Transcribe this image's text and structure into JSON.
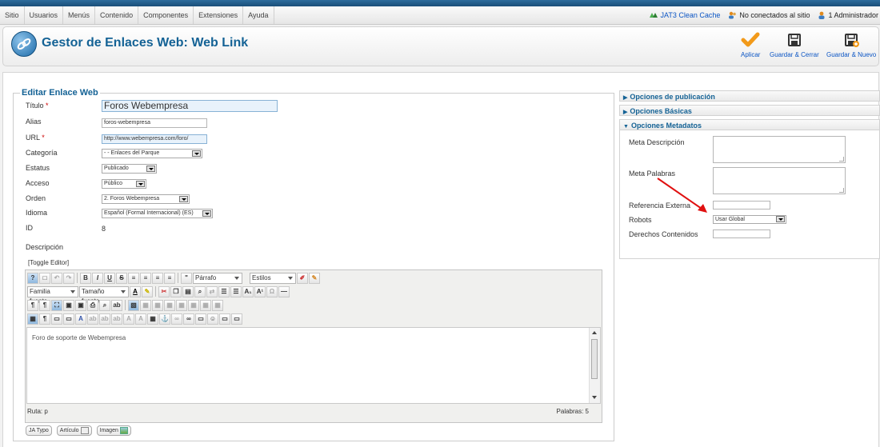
{
  "menu": {
    "items": [
      "Sitio",
      "Usuarios",
      "Menús",
      "Contenido",
      "Componentes",
      "Extensiones",
      "Ayuda"
    ],
    "cache_label": "JAT3 Clean Cache",
    "not_connected": "No conectados al sitio",
    "admin": "1 Administrador"
  },
  "header": {
    "title": "Gestor de Enlaces Web: Web Link",
    "apply_label": "Aplicar",
    "save_close_label": "Guardar & Cerrar",
    "save_new_label": "Guardar & Nuevo"
  },
  "form": {
    "legend": "Editar Enlace Web",
    "title_label": "Título",
    "required_mark": "*",
    "title_value": "Foros Webempresa",
    "alias_label": "Alias",
    "alias_value": "foros-webempresa",
    "url_label": "URL",
    "url_value": "http://www.webempresa.com/foro/",
    "category_label": "Categoría",
    "category_value": "- - Enlaces del Parque",
    "status_label": "Estatus",
    "status_value": "Publicado",
    "access_label": "Acceso",
    "access_value": "Público",
    "order_label": "Orden",
    "order_value": "2. Foros Webempresa",
    "language_label": "Idioma",
    "language_value": "Español (Formal Internacional) (ES)",
    "id_label": "ID",
    "id_value": "8",
    "description_label": "Descripción"
  },
  "editor": {
    "toggle_label": "[Toggle Editor]",
    "format_select": "Párrafo",
    "styles_select": "Estilos",
    "font_family_select": "Familia fuente",
    "font_size_select": "Tamaño fuente",
    "content": "Foro de soporte de Webempresa",
    "path_label": "Ruta: p",
    "word_count": "Palabras: 5"
  },
  "buttons": {
    "jatypo": "JA Typo",
    "article": "Artículo",
    "image": "Imagen"
  },
  "panel": {
    "publish_options": "Opciones de publicación",
    "basic_options": "Opciones Básicas",
    "metadata_options": "Opciones Metadatos",
    "meta_description_label": "Meta Descripción",
    "meta_keywords_label": "Meta Palabras",
    "external_ref_label": "Referencia Externa",
    "robots_label": "Robots",
    "robots_value": "Usar Global",
    "rights_label": "Derechos Contenidos"
  },
  "colors": {
    "brand_blue": "#146295",
    "link_blue": "#0b55c4",
    "apply_orange": "#f29a1a",
    "annotation_red": "#e01010"
  }
}
